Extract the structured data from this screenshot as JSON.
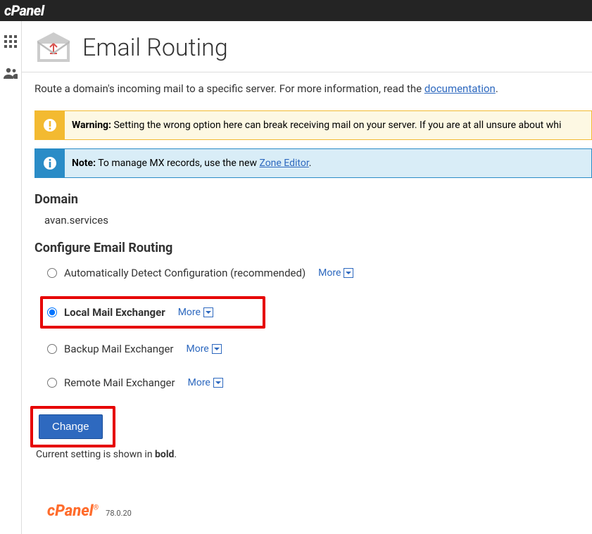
{
  "header": {
    "logo_text": "cPanel"
  },
  "page": {
    "title": "Email Routing",
    "intro_prefix": "Route a domain's incoming mail to a specific server. For more information, read the ",
    "intro_link": "documentation",
    "intro_suffix": "."
  },
  "alerts": {
    "warning_label": "Warning:",
    "warning_text": " Setting the wrong option here can break receiving mail on your server. If you are at all unsure about whi",
    "note_label": "Note:",
    "note_text_prefix": " To manage MX records, use the new ",
    "note_link": "Zone Editor",
    "note_text_suffix": "."
  },
  "domain": {
    "section_title": "Domain",
    "value": "avan.services"
  },
  "routing": {
    "section_title": "Configure Email Routing",
    "options": [
      {
        "label": "Automatically Detect Configuration (recommended)",
        "more": "More",
        "selected": false,
        "bold": false
      },
      {
        "label": "Local Mail Exchanger",
        "more": "More",
        "selected": true,
        "bold": true
      },
      {
        "label": "Backup Mail Exchanger",
        "more": "More",
        "selected": false,
        "bold": false
      },
      {
        "label": "Remote Mail Exchanger",
        "more": "More",
        "selected": false,
        "bold": false
      }
    ],
    "change_button": "Change",
    "current_note_prefix": "Current setting is shown in ",
    "current_note_bold": "bold",
    "current_note_suffix": "."
  },
  "footer": {
    "logo": "cPanel",
    "version": "78.0.20"
  }
}
